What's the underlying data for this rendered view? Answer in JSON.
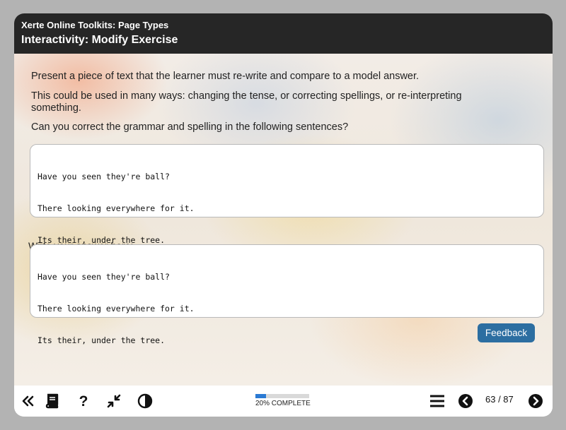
{
  "header": {
    "subtitle": "Xerte Online Toolkits: Page Types",
    "title": "Interactivity: Modify Exercise"
  },
  "content": {
    "paragraphs": [
      "Present a piece of text that the learner must re-write and compare to a model answer.",
      "This could be used in many ways: changing the tense, or correcting spellings, or re-interpreting something.",
      "Can you correct the grammar and spelling in the following sentences?"
    ],
    "source_text": [
      "Have you seen they're ball?",
      "There looking everywhere for it.",
      "Its their, under the tree."
    ],
    "answer_label": "Write your answer here:",
    "answer_text": [
      "Have you seen they're ball?",
      "There looking everywhere for it.",
      "Its their, under the tree."
    ],
    "feedback_label": "Feedback"
  },
  "footer": {
    "icons": [
      "double-chevron-left-icon",
      "book-icon",
      "question-icon",
      "collapse-arrows-icon",
      "contrast-icon",
      "menu-icon",
      "previous-icon",
      "next-icon"
    ],
    "progress_percent": 20,
    "progress_label": "20% COMPLETE",
    "page_counter": "63 / 87"
  },
  "colors": {
    "header_bg": "#262626",
    "accent": "#2c6ea1",
    "progress": "#2b7ad3"
  }
}
